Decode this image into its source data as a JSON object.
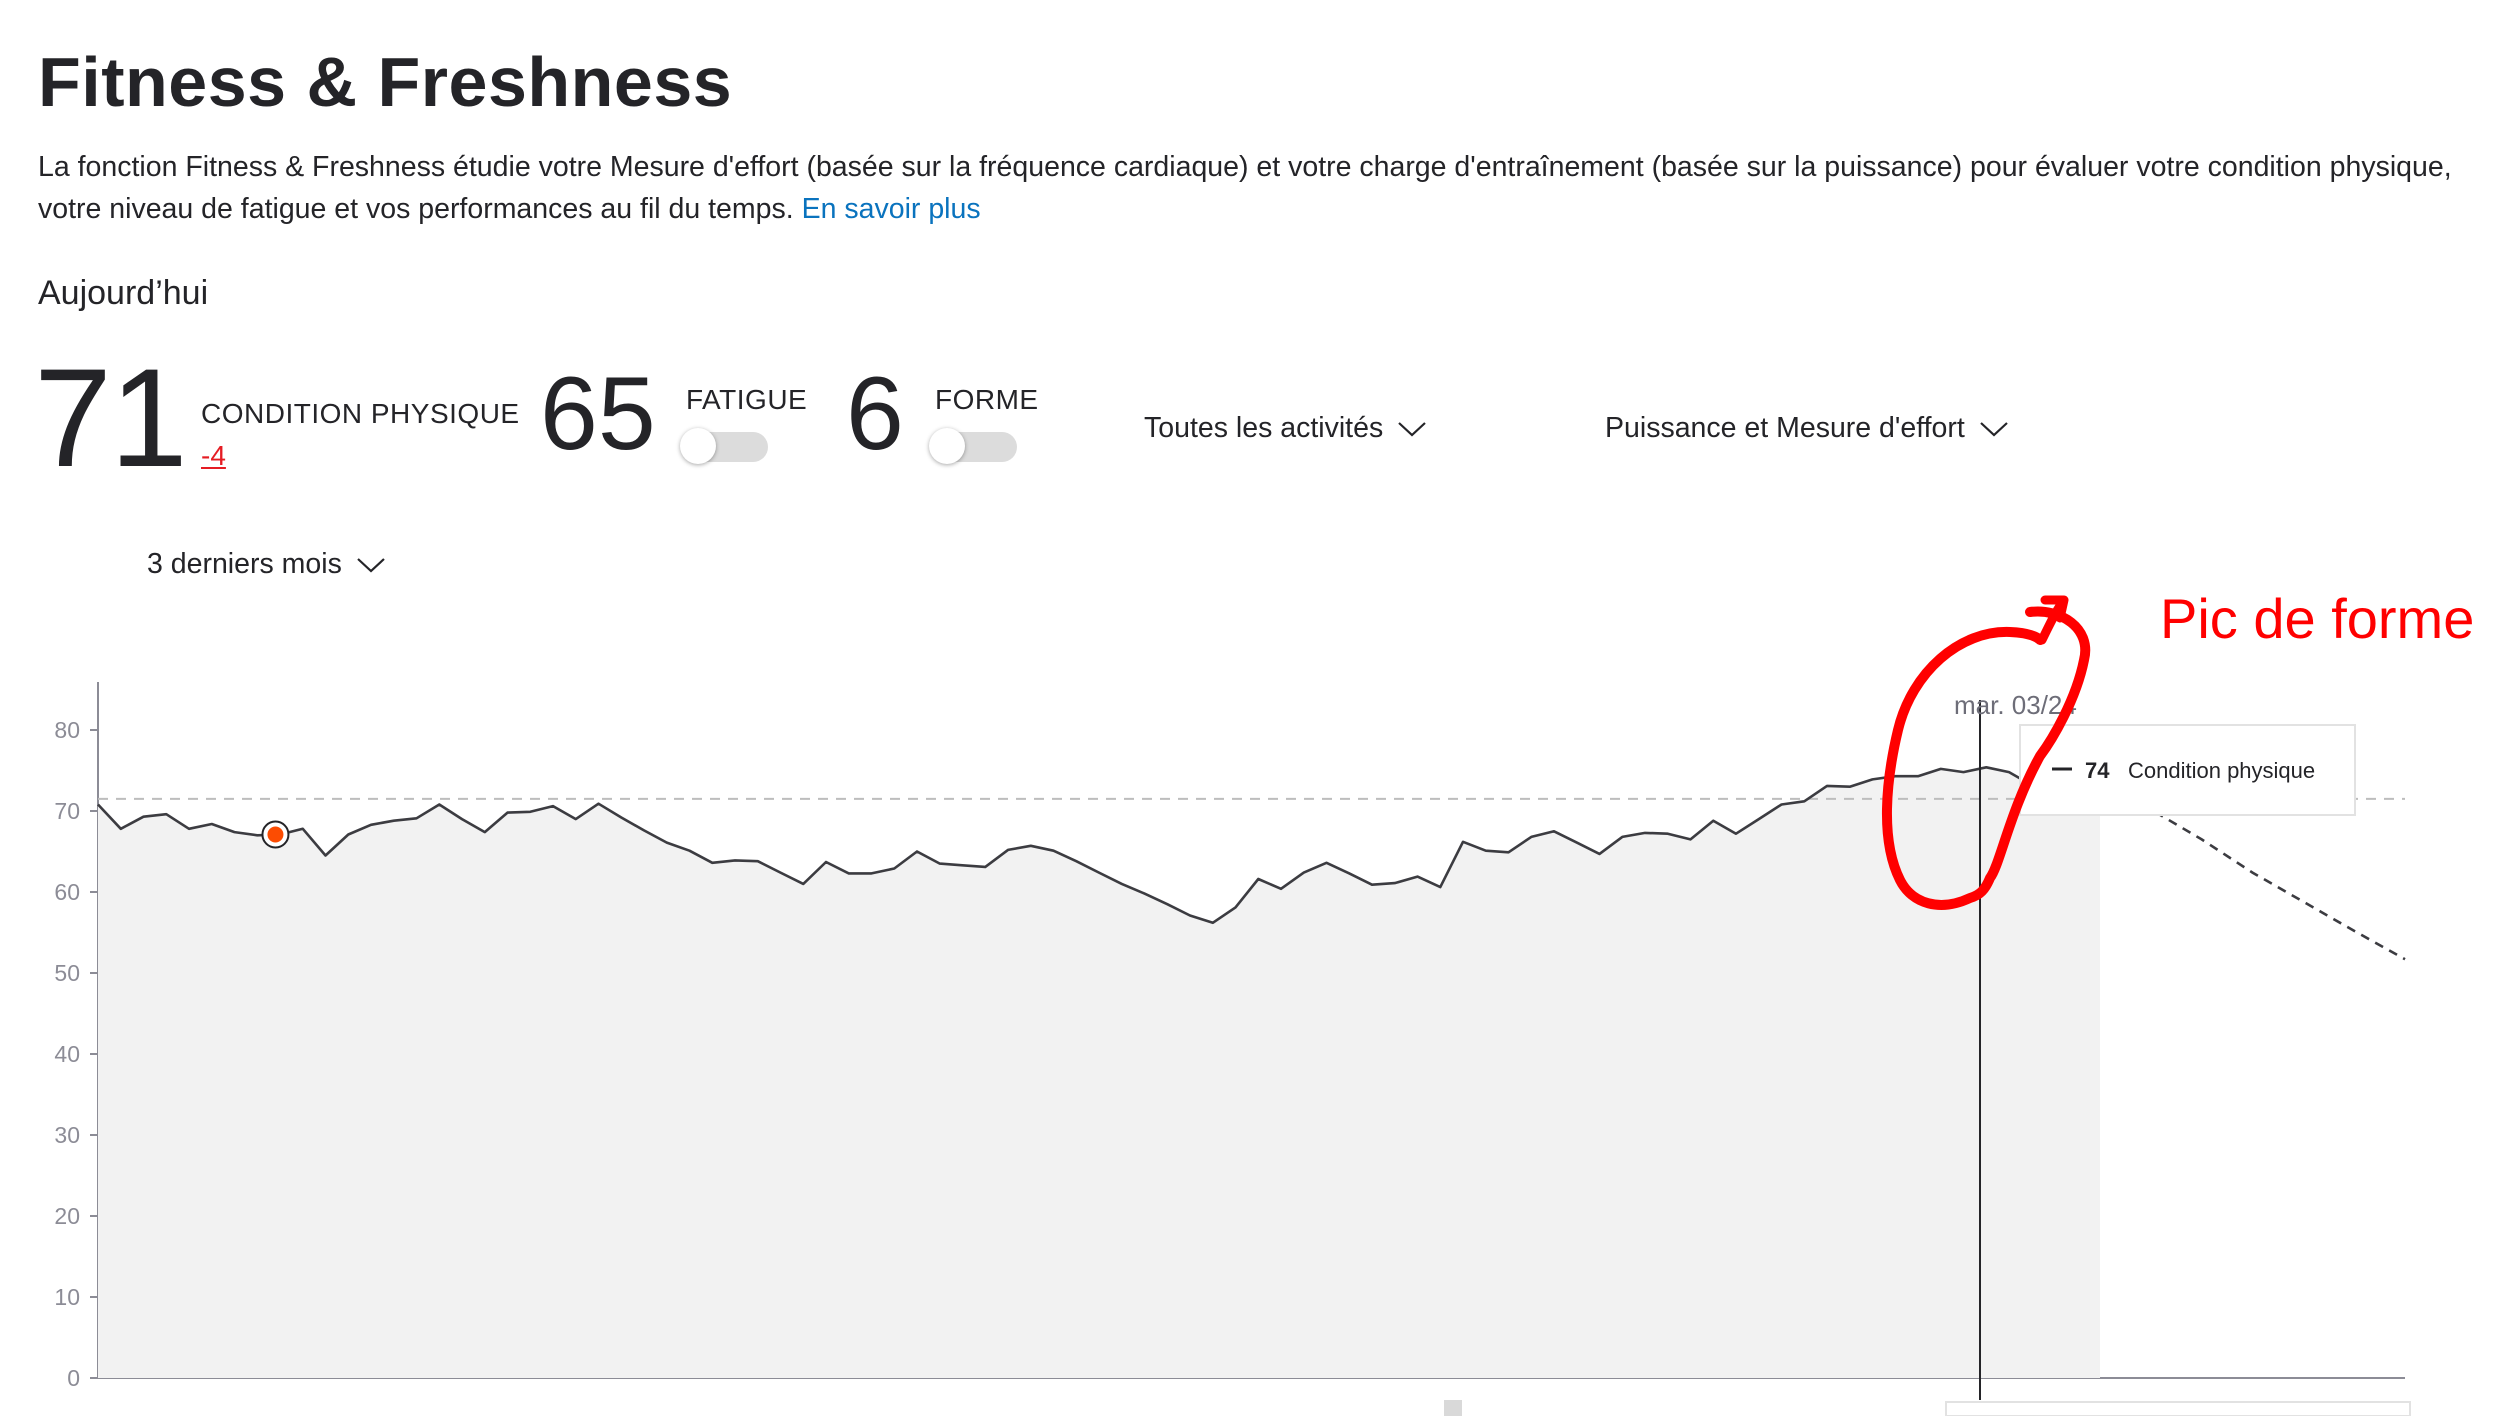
{
  "header": {
    "title": "Fitness & Freshness",
    "description": "La fonction Fitness & Freshness étudie votre Mesure d'effort (basée sur la fréquence cardiaque) et votre charge d'entraînement (basée sur la puissance) pour évaluer votre condition physique, votre niveau de fatigue et vos performances au fil du temps.",
    "learn_more": "En savoir plus"
  },
  "today": {
    "label": "Aujourd’hui",
    "fitness": {
      "value": "71",
      "label": "CONDITION PHYSIQUE",
      "delta": "-4"
    },
    "fatigue": {
      "value": "65",
      "label": "FATIGUE",
      "toggle_on": false
    },
    "form": {
      "value": "6",
      "label": "FORME",
      "toggle_on": false
    }
  },
  "filters": {
    "activities": "Toutes les activités",
    "metric": "Puissance et Mesure d'effort",
    "range": "3 derniers mois"
  },
  "annotation": {
    "text": "Pic de forme",
    "color": "#ff0000"
  },
  "tooltip": {
    "date": "mar. 03/24",
    "value": "74",
    "series": "Condition physique"
  },
  "colors": {
    "accent_orange": "#fc4c02",
    "link": "#0a73be",
    "delta_negative": "#e51c23",
    "annotation": "#ff0000",
    "line": "#3c3c41",
    "area": "#f2f2f2"
  },
  "chart_data": {
    "type": "line",
    "ylim": [
      0,
      80
    ],
    "yticks": [
      "0",
      "10",
      "20",
      "30",
      "40",
      "50",
      "60",
      "70",
      "80"
    ],
    "reference_line": 71.5,
    "series": [
      {
        "values": [
          70.8,
          67.8,
          69.3,
          69.6,
          67.8,
          68.4,
          67.4,
          67,
          67.1,
          67.8,
          64.5,
          67.1,
          68.3,
          68.8,
          69.1,
          70.8,
          69,
          67.4,
          69.8,
          69.9,
          70.6,
          69,
          70.9,
          69.2,
          67.6,
          66.1,
          65.1,
          63.6,
          63.9,
          63.8,
          62.4,
          61,
          63.7,
          62.3,
          62.3,
          62.9,
          65,
          63.5,
          63.3,
          63.1,
          65.2,
          65.7,
          65.1,
          63.8,
          62.4,
          61,
          59.8,
          58.5,
          57.1,
          56.2,
          58.1,
          61.6,
          60.4,
          62.4,
          63.6,
          62.3,
          60.9,
          61.1,
          61.9,
          60.6,
          66.2,
          65.1,
          64.9,
          66.8,
          67.5,
          66.1,
          64.7,
          66.8,
          67.3,
          67.2,
          66.5,
          68.8,
          67.2,
          69,
          70.8,
          71.2,
          73.1,
          73,
          73.9,
          74.3,
          74.3,
          75.2,
          74.8,
          75.4,
          74.8,
          73.2,
          74.8,
          74.4,
          73.9
        ]
      },
      {
        "name": "projection",
        "values": [
          73.9,
          70.2,
          66.5,
          62.4,
          58.8,
          55.2,
          51.7
        ]
      }
    ],
    "highlight_point": 68
  }
}
